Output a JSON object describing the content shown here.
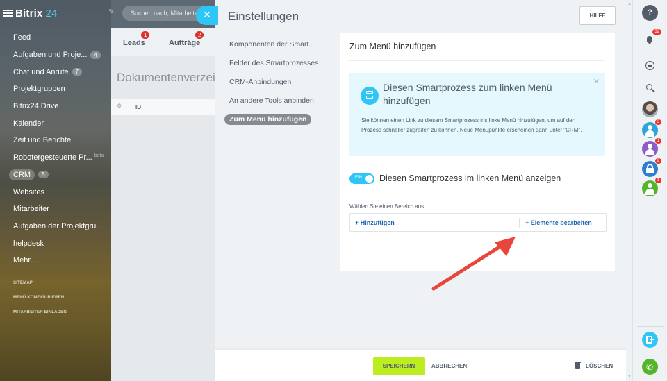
{
  "brand": {
    "name": "Bitrix",
    "number": "24"
  },
  "sidebar": {
    "items": [
      {
        "label": "Feed",
        "count": ""
      },
      {
        "label": "Aufgaben und Proje...",
        "count": "4"
      },
      {
        "label": "Chat und Anrufe",
        "count": "7"
      },
      {
        "label": "Projektgruppen",
        "count": ""
      },
      {
        "label": "Bitrix24.Drive",
        "count": ""
      },
      {
        "label": "Kalender",
        "count": ""
      },
      {
        "label": "Zeit und Berichte",
        "count": ""
      },
      {
        "label": "Robotergesteuerte Pr...",
        "count": "",
        "hint": "beta"
      },
      {
        "label": "CRM",
        "count": "5"
      },
      {
        "label": "Websites",
        "count": ""
      },
      {
        "label": "Mitarbeiter",
        "count": ""
      },
      {
        "label": "Aufgaben der Projektgru...",
        "count": ""
      },
      {
        "label": "helpdesk",
        "count": ""
      },
      {
        "label": "Mehr... ·",
        "count": ""
      }
    ],
    "footer_links": [
      "SITEMAP",
      "MENÜ KONFIGURIEREN",
      "MITARBEITER EINLADEN"
    ]
  },
  "background_page": {
    "search_placeholder": "Suchen nach, Mitarbeiter",
    "tabs": [
      {
        "label": "Leads",
        "badge": "1"
      },
      {
        "label": "Aufträge",
        "badge": "2"
      }
    ],
    "doc_title": "Dokumentenverzeichnis",
    "grid_id": "ID"
  },
  "slider": {
    "close_symbol": "✕",
    "title": "Einstellungen",
    "help_label": "HILFE",
    "menu": [
      {
        "label": "Komponenten der Smart...",
        "active": false
      },
      {
        "label": "Felder des Smartprozesses",
        "active": false
      },
      {
        "label": "CRM-Anbindungen",
        "active": false
      },
      {
        "label": "An andere Tools anbinden",
        "active": false
      },
      {
        "label": "Zum Menü hinzufügen",
        "active": true
      }
    ],
    "card": {
      "title": "Zum Menü hinzufügen",
      "info_title": "Diesen Smartprozess zum linken Menü hinzufügen",
      "info_text": "Sie können einen Link zu diesem Smartprozess ins linke Menü hinzufügen, um auf den Prozess schneller zugreifen zu können. Neue Menüpunkte erscheinen dann unter \"CRM\".",
      "toggle_state": "EIN",
      "toggle_label": "Diesen Smartprozess im linken Menü anzeigen",
      "section_label": "Wählen Sie einen Bereich aus",
      "add_label": "+ Hinzufügen",
      "edit_label": "+ Elemente bearbeiten"
    },
    "footer": {
      "save_label": "SPEICHERN",
      "cancel_label": "ABBRECHEN",
      "delete_label": "LÖSCHEN"
    }
  },
  "rail": {
    "notifications_badge": "32",
    "user_badges": [
      "3",
      "1",
      "2",
      "1"
    ]
  },
  "colors": {
    "accent": "#2fc6f6",
    "save_button": "#bbed21",
    "link": "#2067b0",
    "badge": "#e8362f",
    "annotation_arrow": "#e8453c"
  }
}
